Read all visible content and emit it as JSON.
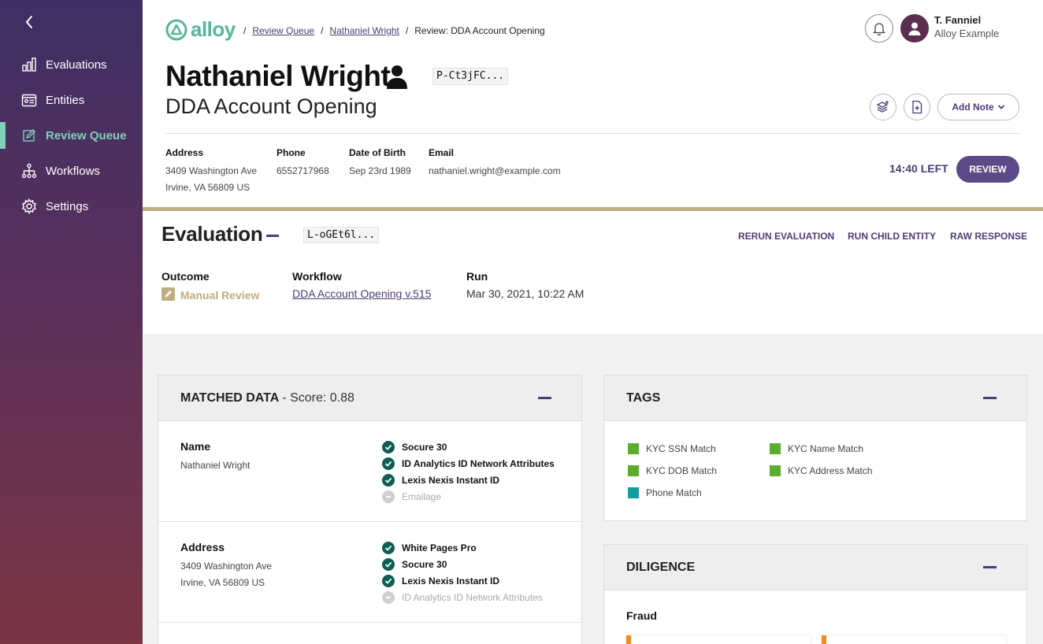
{
  "sidebar": {
    "items": [
      {
        "label": "Evaluations",
        "icon": "bar-chart-icon"
      },
      {
        "label": "Entities",
        "icon": "id-card-icon"
      },
      {
        "label": "Review Queue",
        "icon": "edit-square-icon",
        "active": true
      },
      {
        "label": "Workflows",
        "icon": "hierarchy-icon"
      },
      {
        "label": "Settings",
        "icon": "gear-icon"
      }
    ]
  },
  "header": {
    "logo_text": "alloy",
    "breadcrumb": {
      "sep": "/",
      "item1": "Review Queue",
      "item2": "Nathaniel Wright",
      "current": "Review: DDA Account Opening"
    },
    "user_name": "T. Fanniel",
    "user_org": "Alloy Example"
  },
  "entity": {
    "name": "Nathaniel Wright",
    "id": "P-Ct3jFC...",
    "subtitle": "DDA Account Opening",
    "add_note_label": "Add Note",
    "address_label": "Address",
    "address_line1": "3409 Washington Ave",
    "address_line2": "Irvine, VA 56809 US",
    "phone_label": "Phone",
    "phone": "6552717968",
    "dob_label": "Date of Birth",
    "dob": "Sep 23rd 1989",
    "email_label": "Email",
    "email": "nathaniel.wright@example.com",
    "time_left": "14:40 LEFT",
    "review_label": "REVIEW"
  },
  "evaluation": {
    "title": "Evaluation",
    "id": "L-oGEt6l...",
    "actions": {
      "rerun": "RERUN EVALUATION",
      "child": "RUN CHILD ENTITY",
      "raw": "RAW RESPONSE"
    },
    "outcome_label": "Outcome",
    "outcome": "Manual Review",
    "workflow_label": "Workflow",
    "workflow": "DDA Account Opening v.515",
    "run_label": "Run",
    "run": "Mar 30, 2021, 10:22 AM"
  },
  "matched_data": {
    "title": "MATCHED DATA",
    "score": "- Score: 0.88",
    "rows": [
      {
        "name": "Name",
        "value1": "Nathaniel Wright",
        "value2": "",
        "sources": [
          {
            "label": "Socure 30",
            "status": "ok"
          },
          {
            "label": "ID Analytics ID Network Attributes",
            "status": "ok"
          },
          {
            "label": "Lexis Nexis Instant ID",
            "status": "ok"
          },
          {
            "label": "Emailage",
            "status": "na"
          }
        ]
      },
      {
        "name": "Address",
        "value1": "3409 Washington Ave",
        "value2": "Irvine, VA 56809 US",
        "sources": [
          {
            "label": "White Pages Pro",
            "status": "ok"
          },
          {
            "label": "Socure 30",
            "status": "ok"
          },
          {
            "label": "Lexis Nexis Instant ID",
            "status": "ok"
          },
          {
            "label": "ID Analytics ID Network Attributes",
            "status": "na"
          }
        ]
      }
    ]
  },
  "tags": {
    "title": "TAGS",
    "items": [
      {
        "label": "KYC SSN Match",
        "color": "#5aad2f"
      },
      {
        "label": "KYC Name Match",
        "color": "#5aad2f"
      },
      {
        "label": "KYC DOB Match",
        "color": "#5aad2f"
      },
      {
        "label": "KYC Address Match",
        "color": "#5aad2f"
      },
      {
        "label": "Phone Match",
        "color": "#179c9e"
      }
    ]
  },
  "diligence": {
    "title": "DILIGENCE",
    "section": "Fraud"
  },
  "colors": {
    "accent": "#4d3b75",
    "brand": "#56b59a",
    "manual_review": "#bfae82"
  }
}
